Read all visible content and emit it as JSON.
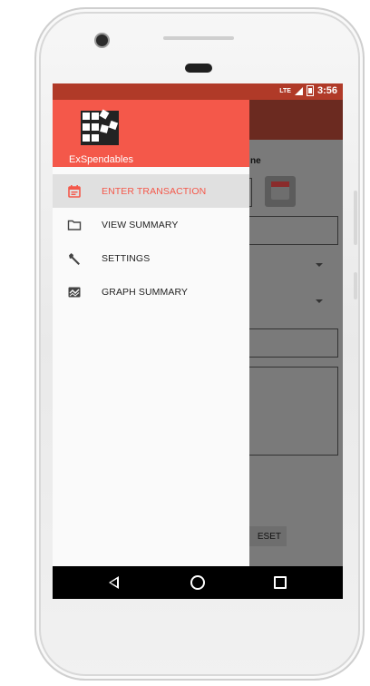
{
  "status_bar": {
    "network": "LTE",
    "time": "3:56"
  },
  "app": {
    "name": "ExSpendables"
  },
  "background_screen": {
    "partial_label": "ne",
    "reset_button_partial": "ESET"
  },
  "drawer": {
    "items": [
      {
        "label": "ENTER TRANSACTION",
        "icon": "calendar-icon",
        "active": true
      },
      {
        "label": "VIEW SUMMARY",
        "icon": "folder-icon",
        "active": false
      },
      {
        "label": "SETTINGS",
        "icon": "wrench-icon",
        "active": false
      },
      {
        "label": "GRAPH SUMMARY",
        "icon": "graph-icon",
        "active": false
      }
    ]
  },
  "colors": {
    "accent": "#f4584a",
    "status_bar": "#b03a28",
    "active_item_bg": "#e0e0e0"
  }
}
